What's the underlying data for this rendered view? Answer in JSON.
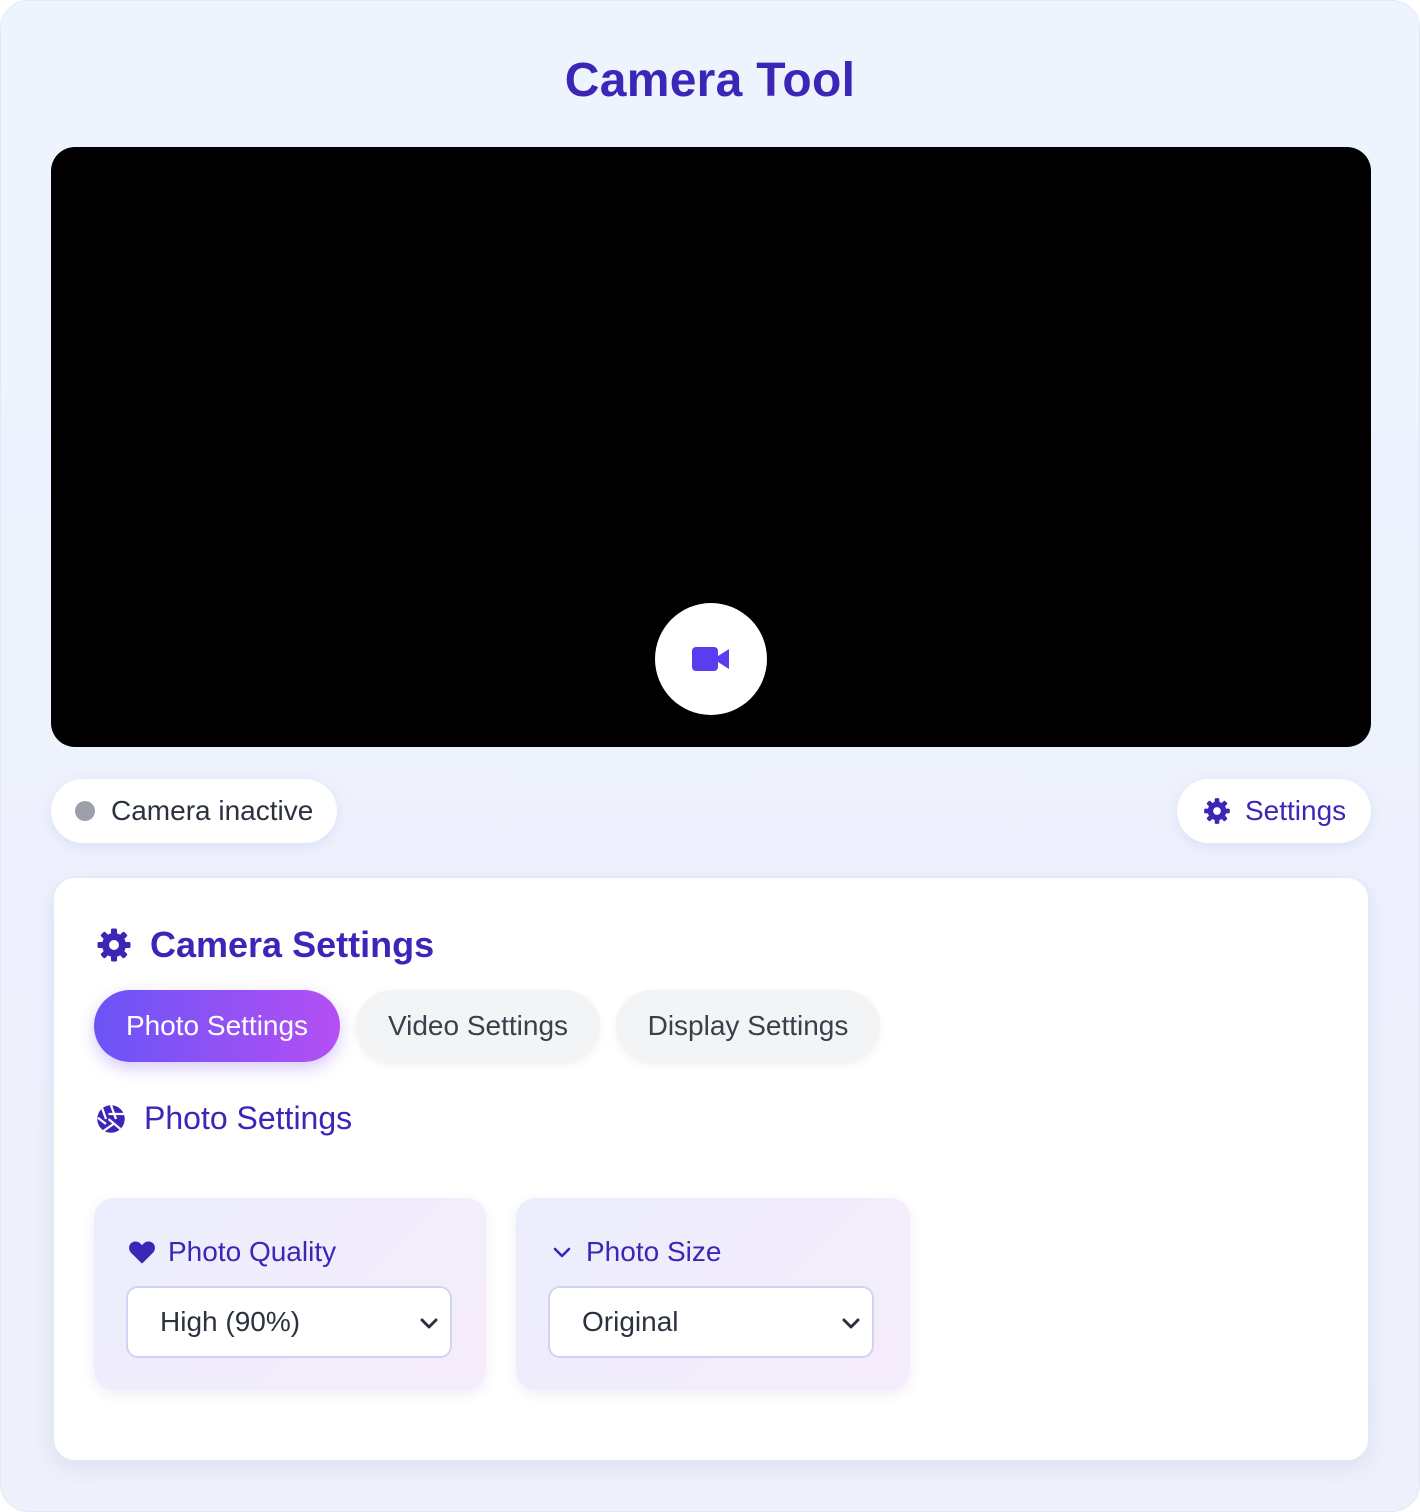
{
  "app": {
    "title": "Camera Tool"
  },
  "viewer": {
    "camera_button_icon": "video-camera-icon"
  },
  "status": {
    "label": "Camera inactive",
    "dot_color": "#9ca0ab"
  },
  "settings_button": {
    "label": "Settings",
    "icon": "gear-icon"
  },
  "panel": {
    "title": "Camera Settings",
    "tabs": [
      {
        "label": "Photo Settings",
        "active": true
      },
      {
        "label": "Video Settings",
        "active": false
      },
      {
        "label": "Display Settings",
        "active": false
      }
    ],
    "section_title": "Photo Settings",
    "section_icon": "aperture-icon",
    "fields": [
      {
        "label": "Photo Quality",
        "icon": "heart-icon",
        "value": "High (90%)"
      },
      {
        "label": "Photo Size",
        "icon": "chevron-down-icon",
        "value": "Original"
      }
    ]
  },
  "colors": {
    "accent": "#3b26b8",
    "camera_icon": "#5b3cf0",
    "tab_gradient_start": "#6a54f6",
    "tab_gradient_end": "#b44ff3"
  }
}
